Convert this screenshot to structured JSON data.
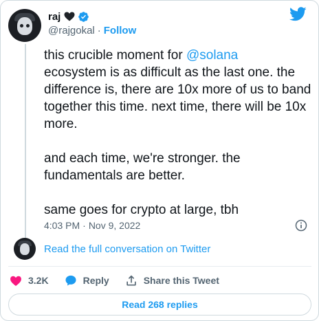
{
  "author": {
    "display_name": "raj",
    "handle": "@rajgokal",
    "separator": "·",
    "follow_label": "Follow",
    "emoji_icon": "black-heart-icon",
    "verified_icon": "verified-badge-icon"
  },
  "brand": {
    "icon": "twitter-bird-icon",
    "color": "#1d9bf0"
  },
  "tweet": {
    "line1_prefix": "this crucible moment for ",
    "mention": "@solana",
    "line1_suffix": "\necosystem is as difficult as the last one. the difference is, there are 10x more of us to band together this time. next time, there will be 10x more.\n\nand each time, we're stronger. the fundamentals are better.\n\nsame goes for crypto at large, tbh",
    "time": "4:03 PM",
    "date": "Nov 9, 2022",
    "meta_separator": "·"
  },
  "conversation": {
    "link_label": "Read the full conversation on Twitter"
  },
  "actions": {
    "like_count": "3.2K",
    "reply_label": "Reply",
    "share_label": "Share this Tweet"
  },
  "replies": {
    "label": "Read 268 replies"
  },
  "colors": {
    "like": "#f91880",
    "link": "#1d9bf0",
    "muted": "#536471",
    "text": "#0f1419"
  }
}
